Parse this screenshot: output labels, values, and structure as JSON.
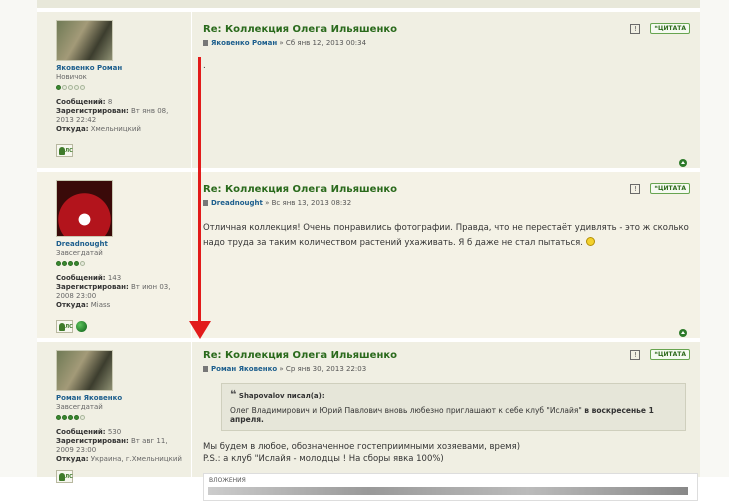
{
  "posts": [
    {
      "username": "Яковенко Роман",
      "rank": "Новичок",
      "stars_filled": 1,
      "stats": [
        {
          "label": "Сообщений:",
          "value": "8"
        },
        {
          "label": "Зарегистрирован:",
          "value": "Вт янв 08, 2013 22:42"
        },
        {
          "label": "Откуда:",
          "value": "Хмельницкий"
        }
      ],
      "title": "Re: Коллекция Олега Ильяшенко",
      "author": "Яковенко Роман",
      "date": "» Сб янв 12, 2013 00:34",
      "text": "."
    },
    {
      "username": "Dreadnought",
      "rank": "Завсегдатай",
      "stars_filled": 4,
      "stats": [
        {
          "label": "Сообщений:",
          "value": "143"
        },
        {
          "label": "Зарегистрирован:",
          "value": "Вт июн 03, 2008 23:00"
        },
        {
          "label": "Откуда:",
          "value": "Miass"
        }
      ],
      "title": "Re: Коллекция Олега Ильяшенко",
      "author": "Dreadnought",
      "date": "» Вс янв 13, 2013 08:32",
      "text": "Отличная коллекция! Очень понравились фотографии. Правда, что не перестаёт удивлять - это ж сколько надо труда за таким количеством растений ухаживать. Я б даже не стал пытаться."
    },
    {
      "username": "Роман Яковенко",
      "rank": "Завсегдатай",
      "stars_filled": 4,
      "stats": [
        {
          "label": "Сообщений:",
          "value": "530"
        },
        {
          "label": "Зарегистрирован:",
          "value": "Вт авг 11, 2009 23:00"
        },
        {
          "label": "Откуда:",
          "value": "Украина, г.Хмельницкий"
        }
      ],
      "title": "Re: Коллекция Олега Ильяшенко",
      "author": "Роман Яковенко",
      "date": "» Ср янв 30, 2013 22:03",
      "quote_author": "Shapovalov писал(а):",
      "quote_text": "Олег Владимирович и Юрий Павлович вновь любезно приглашают к себе клуб \"Ислайя\"",
      "quote_bold": "в воскресенье 1 апреля.",
      "text_lines": [
        "Мы будем в любое, обозначенное гостеприимными хозяевами, время)",
        "P.S.: а клуб \"Ислайя - молодцы ! На сборы явка 100%)"
      ],
      "attachments_label": "ВЛОЖЕНИЯ"
    }
  ],
  "quote_label": "ЦИТАТА",
  "pm_label": "ЛС",
  "colors": {
    "title_green": "#2a6a1c",
    "username_blue": "#1c5e8d",
    "post_bg": "#f0efe3",
    "arrow_red": "#e21b1b"
  }
}
